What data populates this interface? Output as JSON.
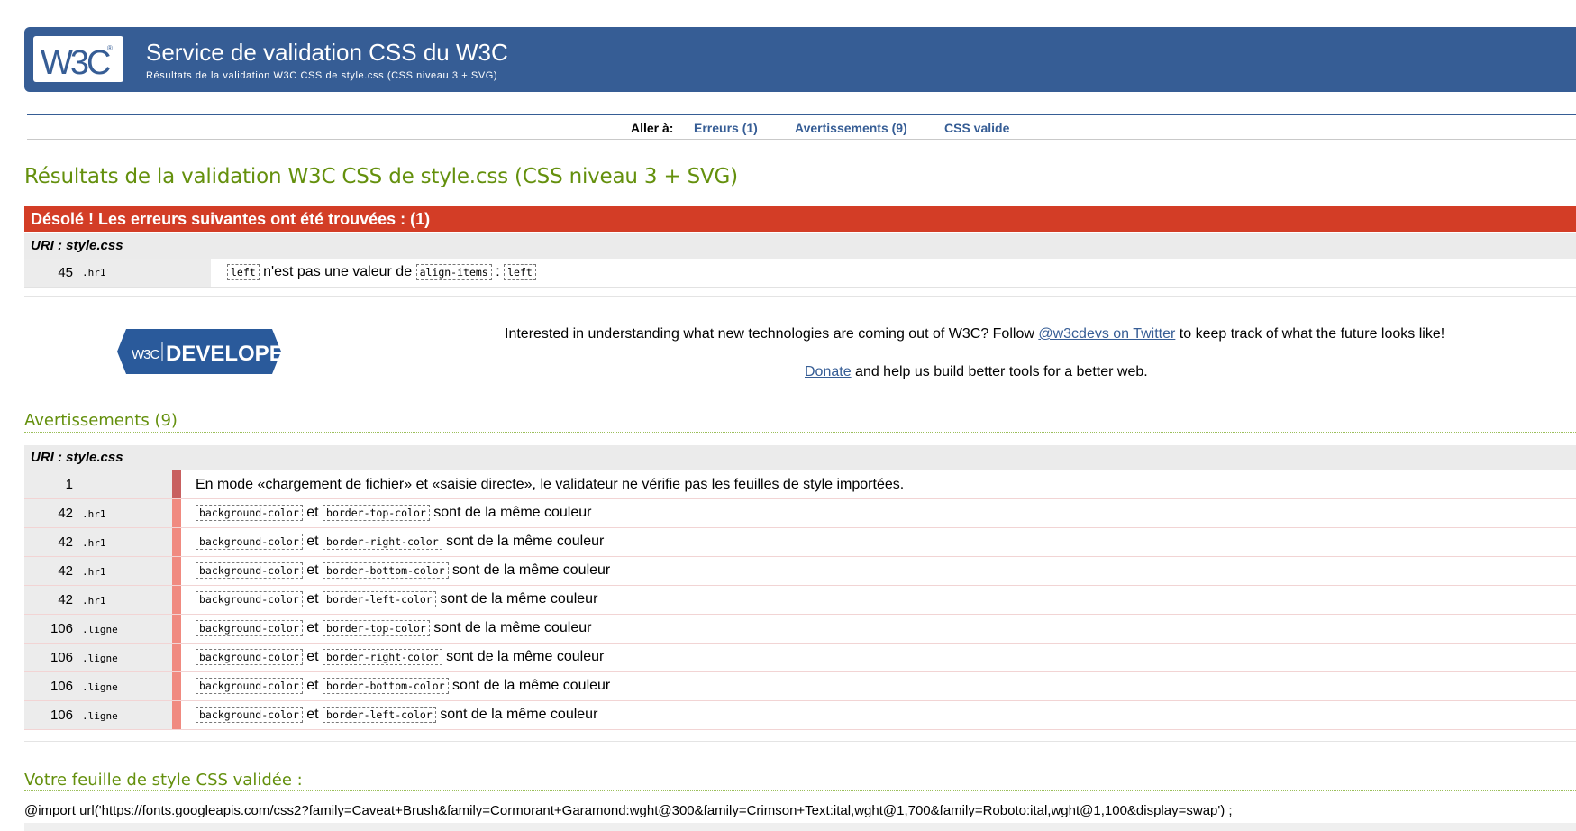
{
  "header": {
    "title": "Service de validation CSS du W3C",
    "subtitle": "Résultats de la validation W3C CSS de style.css (CSS niveau 3 + SVG)",
    "logo_text": "W3C"
  },
  "nav": {
    "goto_label": "Aller à:",
    "errors_link": "Erreurs (1)",
    "warnings_link": "Avertissements (9)",
    "valid_link": "CSS valide"
  },
  "results_heading": "Résultats de la validation W3C CSS de style.css (CSS niveau 3 + SVG)",
  "errors": {
    "banner": "Désolé ! Les erreurs suivantes ont été trouvées : (1)",
    "uri": "URI : style.css",
    "rows": [
      {
        "line": "45",
        "context": ".hr1",
        "value": "left",
        "text": "n'est pas une valeur de",
        "property": "align-items",
        "sep": ":",
        "value2": "left"
      }
    ]
  },
  "promo": {
    "badge_text": "DEVELOPERS",
    "line1_before": "Interested in understanding what new technologies are coming out of W3C? Follow ",
    "line1_link": "@w3cdevs on Twitter",
    "line1_after": " to keep track of what the future looks like!",
    "line2_link": "Donate",
    "line2_after": " and help us build better tools for a better web."
  },
  "warnings": {
    "heading": "Avertissements (9)",
    "uri": "URI : style.css",
    "first": {
      "line": "1",
      "context": "",
      "text": "En mode «chargement de fichier» et «saisie directe», le validateur ne vérifie pas les feuilles de style importées."
    },
    "rows": [
      {
        "line": "42",
        "context": ".hr1",
        "p1": "background-color",
        "and": "et",
        "p2": "border-top-color",
        "tail": "sont de la même couleur"
      },
      {
        "line": "42",
        "context": ".hr1",
        "p1": "background-color",
        "and": "et",
        "p2": "border-right-color",
        "tail": "sont de la même couleur"
      },
      {
        "line": "42",
        "context": ".hr1",
        "p1": "background-color",
        "and": "et",
        "p2": "border-bottom-color",
        "tail": "sont de la même couleur"
      },
      {
        "line": "42",
        "context": ".hr1",
        "p1": "background-color",
        "and": "et",
        "p2": "border-left-color",
        "tail": "sont de la même couleur"
      },
      {
        "line": "106",
        "context": ".ligne",
        "p1": "background-color",
        "and": "et",
        "p2": "border-top-color",
        "tail": "sont de la même couleur"
      },
      {
        "line": "106",
        "context": ".ligne",
        "p1": "background-color",
        "and": "et",
        "p2": "border-right-color",
        "tail": "sont de la même couleur"
      },
      {
        "line": "106",
        "context": ".ligne",
        "p1": "background-color",
        "and": "et",
        "p2": "border-bottom-color",
        "tail": "sont de la même couleur"
      },
      {
        "line": "106",
        "context": ".ligne",
        "p1": "background-color",
        "and": "et",
        "p2": "border-left-color",
        "tail": "sont de la même couleur"
      }
    ]
  },
  "validated": {
    "heading": "Votre feuille de style CSS validée :",
    "import_line": "@import url('https://fonts.googleapis.com/css2?family=Caveat+Brush&family=Cormorant+Garamond:wght@300&family=Crimson+Text:ital,wght@1,700&family=Roboto:ital,wght@1,100&display=swap') ;"
  },
  "colors": {
    "banner": "#365d95",
    "error": "#d33d26",
    "heading_green": "#64900d",
    "warning_bar": "#f08a80"
  }
}
